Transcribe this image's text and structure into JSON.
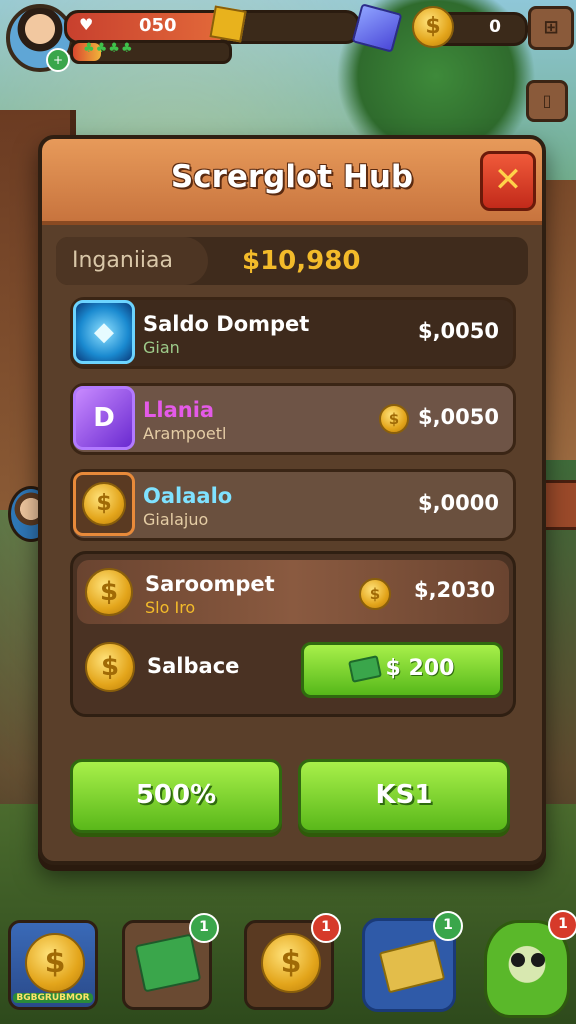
{
  "hud": {
    "xp_value": "050",
    "coin_value": "0",
    "avatar_badge": "+",
    "xp_progress": 0.55,
    "hp_progress": 0.18
  },
  "modal": {
    "title": "Screrglot Hub",
    "close_symbol": "✕",
    "balance_label": "Inganiiaa",
    "balance_value": "$10,980"
  },
  "rows": [
    {
      "title": "Saldo Dompet",
      "subtitle": "Gian",
      "amount": "$,0050",
      "icon": "blue-gem-icon"
    },
    {
      "title": "Llania",
      "subtitle": "Arampoetl",
      "amount": "$,0050",
      "icon": "purple-gem-icon"
    },
    {
      "title": "Oalaalo",
      "subtitle": "Gialajuo",
      "amount": "$,0000",
      "icon": "gold-coin-icon"
    }
  ],
  "group": {
    "title": "Saroompet",
    "subtitle": "Slo Iro",
    "amount": "$,2030",
    "salvage_label": "Salbace",
    "buy_label": "$ 200"
  },
  "buttons": {
    "left_label": "500%",
    "right_label": "KS1"
  },
  "nav": {
    "item1_label": "BGBGRUBMOR",
    "badge2": "1",
    "badge3": "1",
    "badge4": "1",
    "badge5": "1"
  },
  "colors": {
    "accent_green": "#5ab81a",
    "header_orange": "#c8743e",
    "balance_gold": "#f3bb2a"
  }
}
